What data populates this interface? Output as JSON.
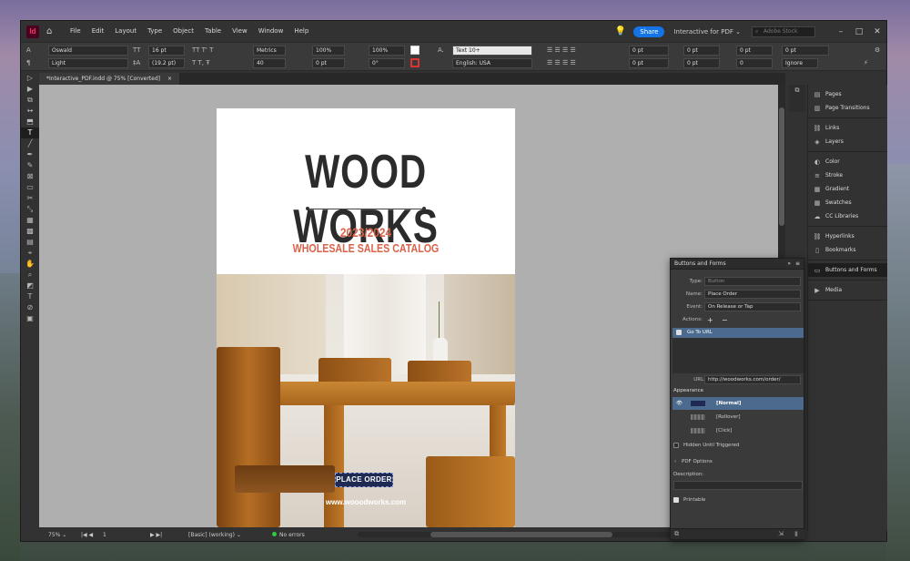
{
  "app": {
    "logo": "Id",
    "menu": [
      "File",
      "Edit",
      "Layout",
      "Type",
      "Object",
      "Table",
      "View",
      "Window",
      "Help"
    ],
    "share_label": "Share",
    "workspace": "Interactive for PDF",
    "stock_placeholder": "Adobe Stock"
  },
  "control_bar": {
    "font_family": "Oswald",
    "font_style": "Light",
    "font_size": "16 pt",
    "leading": "(19.2 pt)",
    "kerning": "Metrics",
    "tracking": "40",
    "vscale": "100%",
    "hscale": "100%",
    "baseline": "0 pt",
    "skew": "0°",
    "char_style": "Text 10+",
    "language": "English: USA",
    "indent_left": "0 pt",
    "indent_first": "0 pt",
    "space_before": "0 pt",
    "space_after": "0 pt",
    "indent_right": "0 pt",
    "indent_last": "0 pt",
    "drop_cap": "0",
    "hyphen": "Ignore"
  },
  "document": {
    "tab_title": "*Interactive_PDF.indd @ 75% [Converted]",
    "close_glyph": "×"
  },
  "page": {
    "title": "WOOD WORKS",
    "year": "2023/2024",
    "subtitle": "WHOLESALE SALES CATALOG",
    "button_label": "PLACE ORDER",
    "url_text": "www.wooodworks.com"
  },
  "status": {
    "zoom": "75%",
    "page": "1",
    "style": "[Basic] (working)",
    "errors": "No errors"
  },
  "dock": {
    "group1": [
      "Pages",
      "Page Transitions"
    ],
    "group2": [
      "Links",
      "Layers"
    ],
    "group3": [
      "Color",
      "Stroke",
      "Gradient",
      "Swatches",
      "CC Libraries"
    ],
    "group4": [
      "Hyperlinks",
      "Bookmarks"
    ],
    "group5": [
      "Buttons and Forms"
    ],
    "group6": [
      "Media"
    ]
  },
  "buttons_forms": {
    "title": "Buttons and Forms",
    "type_label": "Type:",
    "type_value": "Button",
    "name_label": "Name:",
    "name_value": "Place Order",
    "event_label": "Event:",
    "event_value": "On Release or Tap",
    "actions_label": "Actions:",
    "action_item": "Go To URL",
    "url_label": "URL:",
    "url_value": "http://woodworks.com/order/",
    "appearance_label": "Appearance",
    "states": [
      "[Normal]",
      "[Rollover]",
      "[Click]"
    ],
    "hidden_label": "Hidden Until Triggered",
    "pdf_options_label": "PDF Options",
    "description_label": "Description:",
    "printable_label": "Printable"
  }
}
